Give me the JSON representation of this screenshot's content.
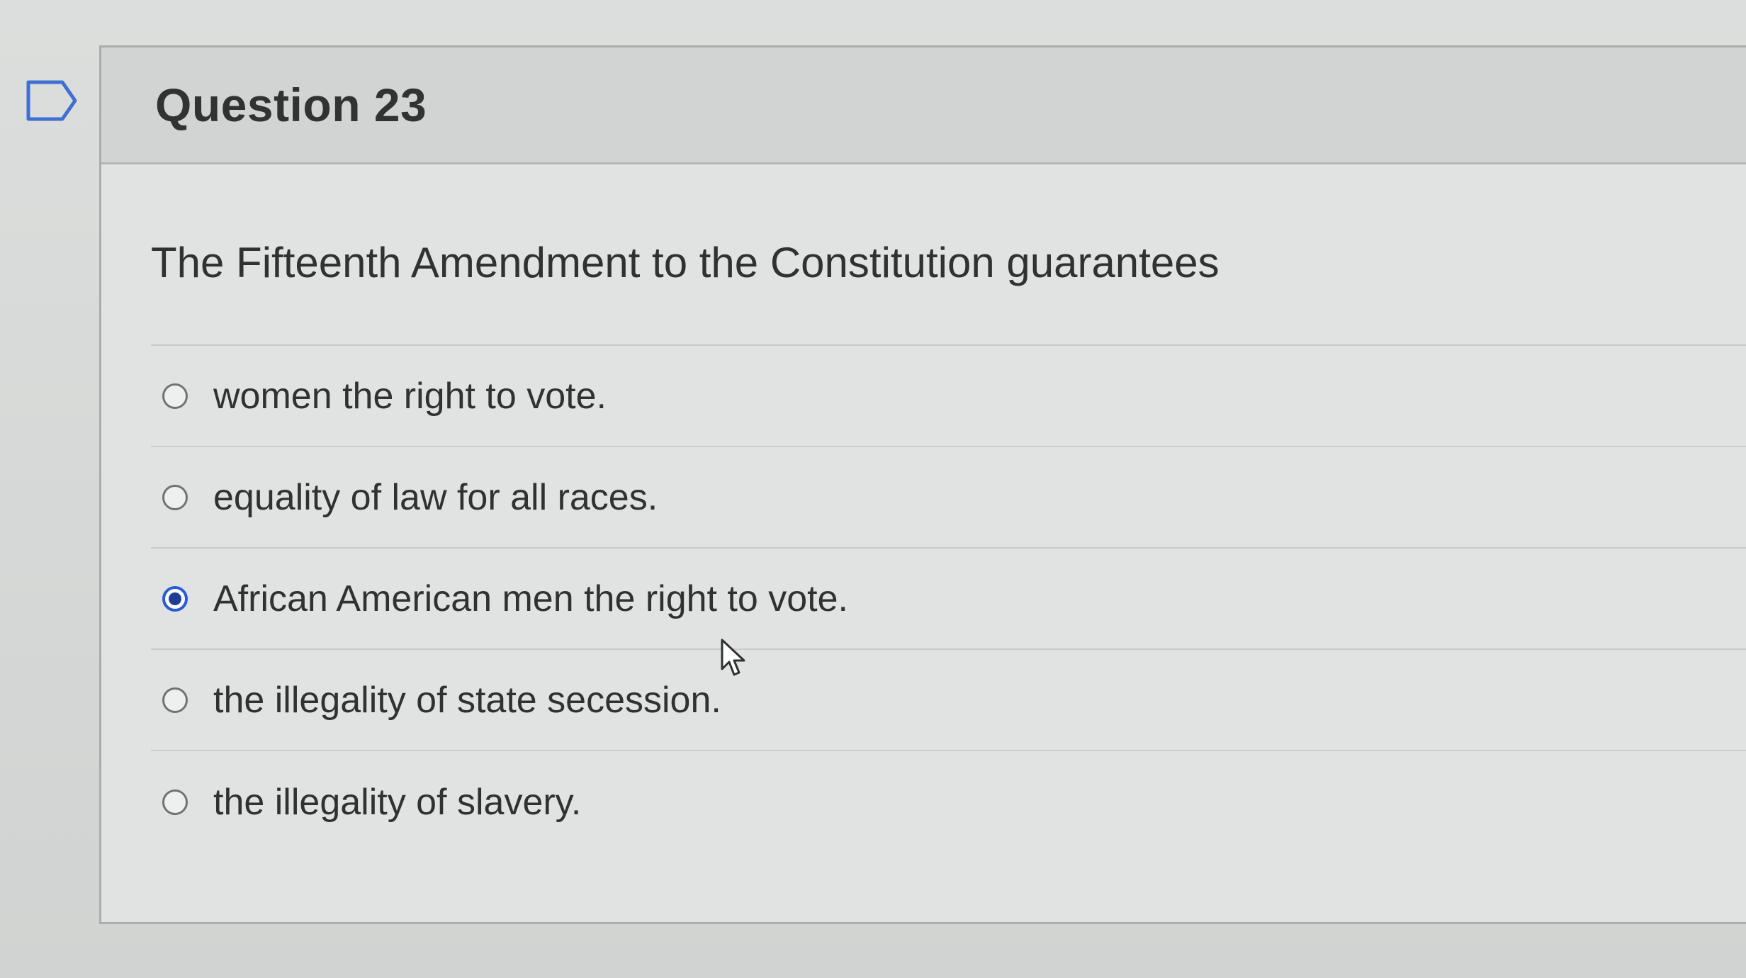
{
  "question": {
    "title": "Question 23",
    "prompt": "The Fifteenth Amendment to the Constitution guarantees",
    "answers": [
      {
        "label": "women the right to vote.",
        "selected": false
      },
      {
        "label": "equality of law for all races.",
        "selected": false
      },
      {
        "label": "African American men the right to vote.",
        "selected": true
      },
      {
        "label": "the illegality of state secession.",
        "selected": false
      },
      {
        "label": "the illegality of slavery.",
        "selected": false
      }
    ]
  },
  "icons": {
    "flag": "flag-outline-icon",
    "cursor": "mouse-pointer-icon"
  },
  "colors": {
    "selected_radio": "#2a5bd7",
    "page_background": "#d7d9d8",
    "header_background": "#d2d4d3"
  }
}
